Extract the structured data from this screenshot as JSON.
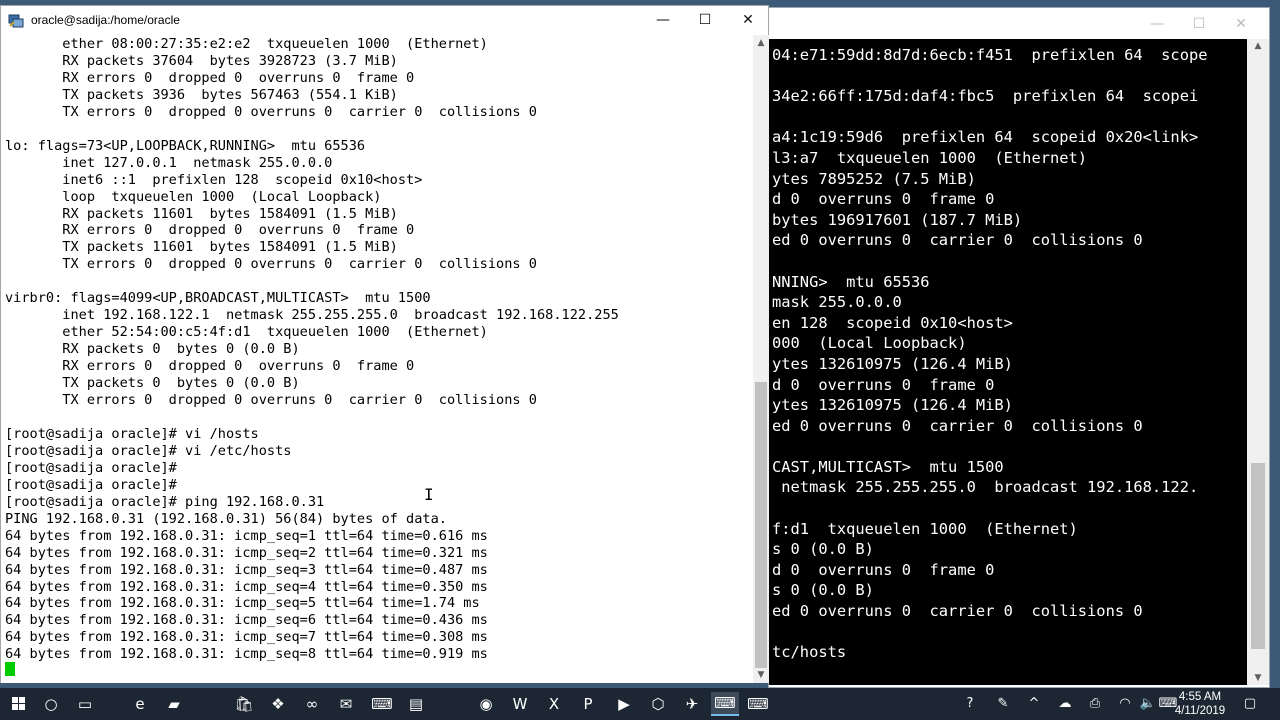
{
  "front_window": {
    "title": "oracle@sadija:/home/oracle",
    "lines": [
      "       ether 08:00:27:35:e2:e2  txqueuelen 1000  (Ethernet)",
      "       RX packets 37604  bytes 3928723 (3.7 MiB)",
      "       RX errors 0  dropped 0  overruns 0  frame 0",
      "       TX packets 3936  bytes 567463 (554.1 KiB)",
      "       TX errors 0  dropped 0 overruns 0  carrier 0  collisions 0",
      "",
      "lo: flags=73<UP,LOOPBACK,RUNNING>  mtu 65536",
      "       inet 127.0.0.1  netmask 255.0.0.0",
      "       inet6 ::1  prefixlen 128  scopeid 0x10<host>",
      "       loop  txqueuelen 1000  (Local Loopback)",
      "       RX packets 11601  bytes 1584091 (1.5 MiB)",
      "       RX errors 0  dropped 0  overruns 0  frame 0",
      "       TX packets 11601  bytes 1584091 (1.5 MiB)",
      "       TX errors 0  dropped 0 overruns 0  carrier 0  collisions 0",
      "",
      "virbr0: flags=4099<UP,BROADCAST,MULTICAST>  mtu 1500",
      "       inet 192.168.122.1  netmask 255.255.255.0  broadcast 192.168.122.255",
      "       ether 52:54:00:c5:4f:d1  txqueuelen 1000  (Ethernet)",
      "       RX packets 0  bytes 0 (0.0 B)",
      "       RX errors 0  dropped 0  overruns 0  frame 0",
      "       TX packets 0  bytes 0 (0.0 B)",
      "       TX errors 0  dropped 0 overruns 0  carrier 0  collisions 0",
      "",
      "[root@sadija oracle]# vi /hosts",
      "[root@sadija oracle]# vi /etc/hosts",
      "[root@sadija oracle]#",
      "[root@sadija oracle]#",
      "[root@sadija oracle]# ping 192.168.0.31",
      "PING 192.168.0.31 (192.168.0.31) 56(84) bytes of data.",
      "64 bytes from 192.168.0.31: icmp_seq=1 ttl=64 time=0.616 ms",
      "64 bytes from 192.168.0.31: icmp_seq=2 ttl=64 time=0.321 ms",
      "64 bytes from 192.168.0.31: icmp_seq=3 ttl=64 time=0.487 ms",
      "64 bytes from 192.168.0.31: icmp_seq=4 ttl=64 time=0.350 ms",
      "64 bytes from 192.168.0.31: icmp_seq=5 ttl=64 time=1.74 ms",
      "64 bytes from 192.168.0.31: icmp_seq=6 ttl=64 time=0.436 ms",
      "64 bytes from 192.168.0.31: icmp_seq=7 ttl=64 time=0.308 ms",
      "64 bytes from 192.168.0.31: icmp_seq=8 ttl=64 time=0.919 ms"
    ],
    "minimize_glyph": "—",
    "maximize_glyph": "☐",
    "close_glyph": "✕"
  },
  "back_window": {
    "minimize_glyph": "—",
    "maximize_glyph": "☐",
    "close_glyph": "✕",
    "lines": [
      "04:e71:59dd:8d7d:6ecb:f451  prefixlen 64  scope",
      "",
      "34e2:66ff:175d:daf4:fbc5  prefixlen 64  scopei",
      "",
      "a4:1c19:59d6  prefixlen 64  scopeid 0x20<link>",
      "l3:a7  txqueuelen 1000  (Ethernet)",
      "ytes 7895252 (7.5 MiB)",
      "d 0  overruns 0  frame 0",
      "bytes 196917601 (187.7 MiB)",
      "ed 0 overruns 0  carrier 0  collisions 0",
      "",
      "NNING>  mtu 65536",
      "mask 255.0.0.0",
      "en 128  scopeid 0x10<host>",
      "000  (Local Loopback)",
      "ytes 132610975 (126.4 MiB)",
      "d 0  overruns 0  frame 0",
      "ytes 132610975 (126.4 MiB)",
      "ed 0 overruns 0  carrier 0  collisions 0",
      "",
      "CAST,MULTICAST>  mtu 1500",
      " netmask 255.255.255.0  broadcast 192.168.122.",
      "",
      "f:d1  txqueuelen 1000  (Ethernet)",
      "s 0 (0.0 B)",
      "d 0  overruns 0  frame 0",
      "s 0 (0.0 B)",
      "ed 0 overruns 0  carrier 0  collisions 0",
      "",
      "tc/hosts"
    ]
  },
  "taskbar": {
    "start_icon": "windows-start-icon",
    "apps": [
      {
        "name": "search-icon",
        "glyph": "○"
      },
      {
        "name": "task-view-icon",
        "glyph": "▭"
      },
      {
        "name": "edge-icon",
        "glyph": "e"
      },
      {
        "name": "file-explorer-icon",
        "glyph": "▰"
      },
      {
        "name": "store-icon",
        "glyph": "🛍"
      },
      {
        "name": "dropbox-icon",
        "glyph": "❖"
      },
      {
        "name": "infinity-app-icon",
        "glyph": "∞"
      },
      {
        "name": "mail-icon",
        "glyph": "✉"
      },
      {
        "name": "putty-icon",
        "glyph": "⌨"
      },
      {
        "name": "notepad-icon",
        "glyph": "▤"
      },
      {
        "name": "chrome-icon",
        "glyph": "◉"
      },
      {
        "name": "word-icon",
        "glyph": "W"
      },
      {
        "name": "excel-icon",
        "glyph": "X"
      },
      {
        "name": "powerpoint-icon",
        "glyph": "P"
      },
      {
        "name": "youtube-icon",
        "glyph": "▶"
      },
      {
        "name": "virtualbox-icon",
        "glyph": "⬡"
      },
      {
        "name": "app-icon-17",
        "glyph": "✈"
      },
      {
        "name": "putty-icon-2",
        "glyph": "⌨"
      },
      {
        "name": "putty-icon-3",
        "glyph": "⌨"
      },
      {
        "name": "recorder-icon",
        "glyph": "⚙"
      }
    ],
    "tray": [
      {
        "name": "help-icon",
        "glyph": "?"
      },
      {
        "name": "people-icon",
        "glyph": "✎"
      },
      {
        "name": "chevron-up-icon",
        "glyph": "^"
      },
      {
        "name": "cloud-icon",
        "glyph": "☁"
      },
      {
        "name": "printer-icon",
        "glyph": "⎙"
      },
      {
        "name": "wifi-icon",
        "glyph": "◠"
      },
      {
        "name": "volume-icon",
        "glyph": "🔈"
      },
      {
        "name": "keyboard-icon",
        "glyph": "⌨"
      }
    ],
    "time": "4:55 AM",
    "date": "4/11/2019",
    "notification_glyph": "▢"
  },
  "colors": {
    "taskbar": "#1d2733",
    "back_terminal_bg": "#000000",
    "front_terminal_bg": "#ffffff",
    "cursor": "#00cc00"
  }
}
